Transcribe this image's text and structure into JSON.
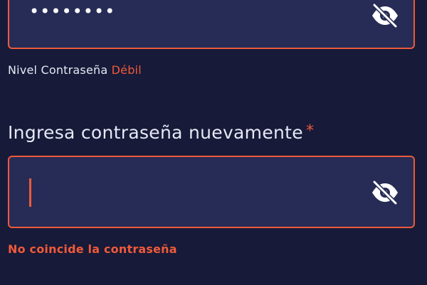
{
  "password_field": {
    "masked_value": "••••••••",
    "visibility_toggle_icon": "eye-slash-icon"
  },
  "strength": {
    "label": "Nivel Contraseña",
    "value": "Débil"
  },
  "confirm_field": {
    "label": "Ingresa contraseña nuevamente",
    "required_marker": "*",
    "value": "",
    "visibility_toggle_icon": "eye-slash-icon"
  },
  "error_message": "No coincide la contraseña",
  "colors": {
    "background": "#171a38",
    "field_background": "#262c55",
    "accent_error": "#ec5a3b",
    "text": "#e6e8f5"
  }
}
